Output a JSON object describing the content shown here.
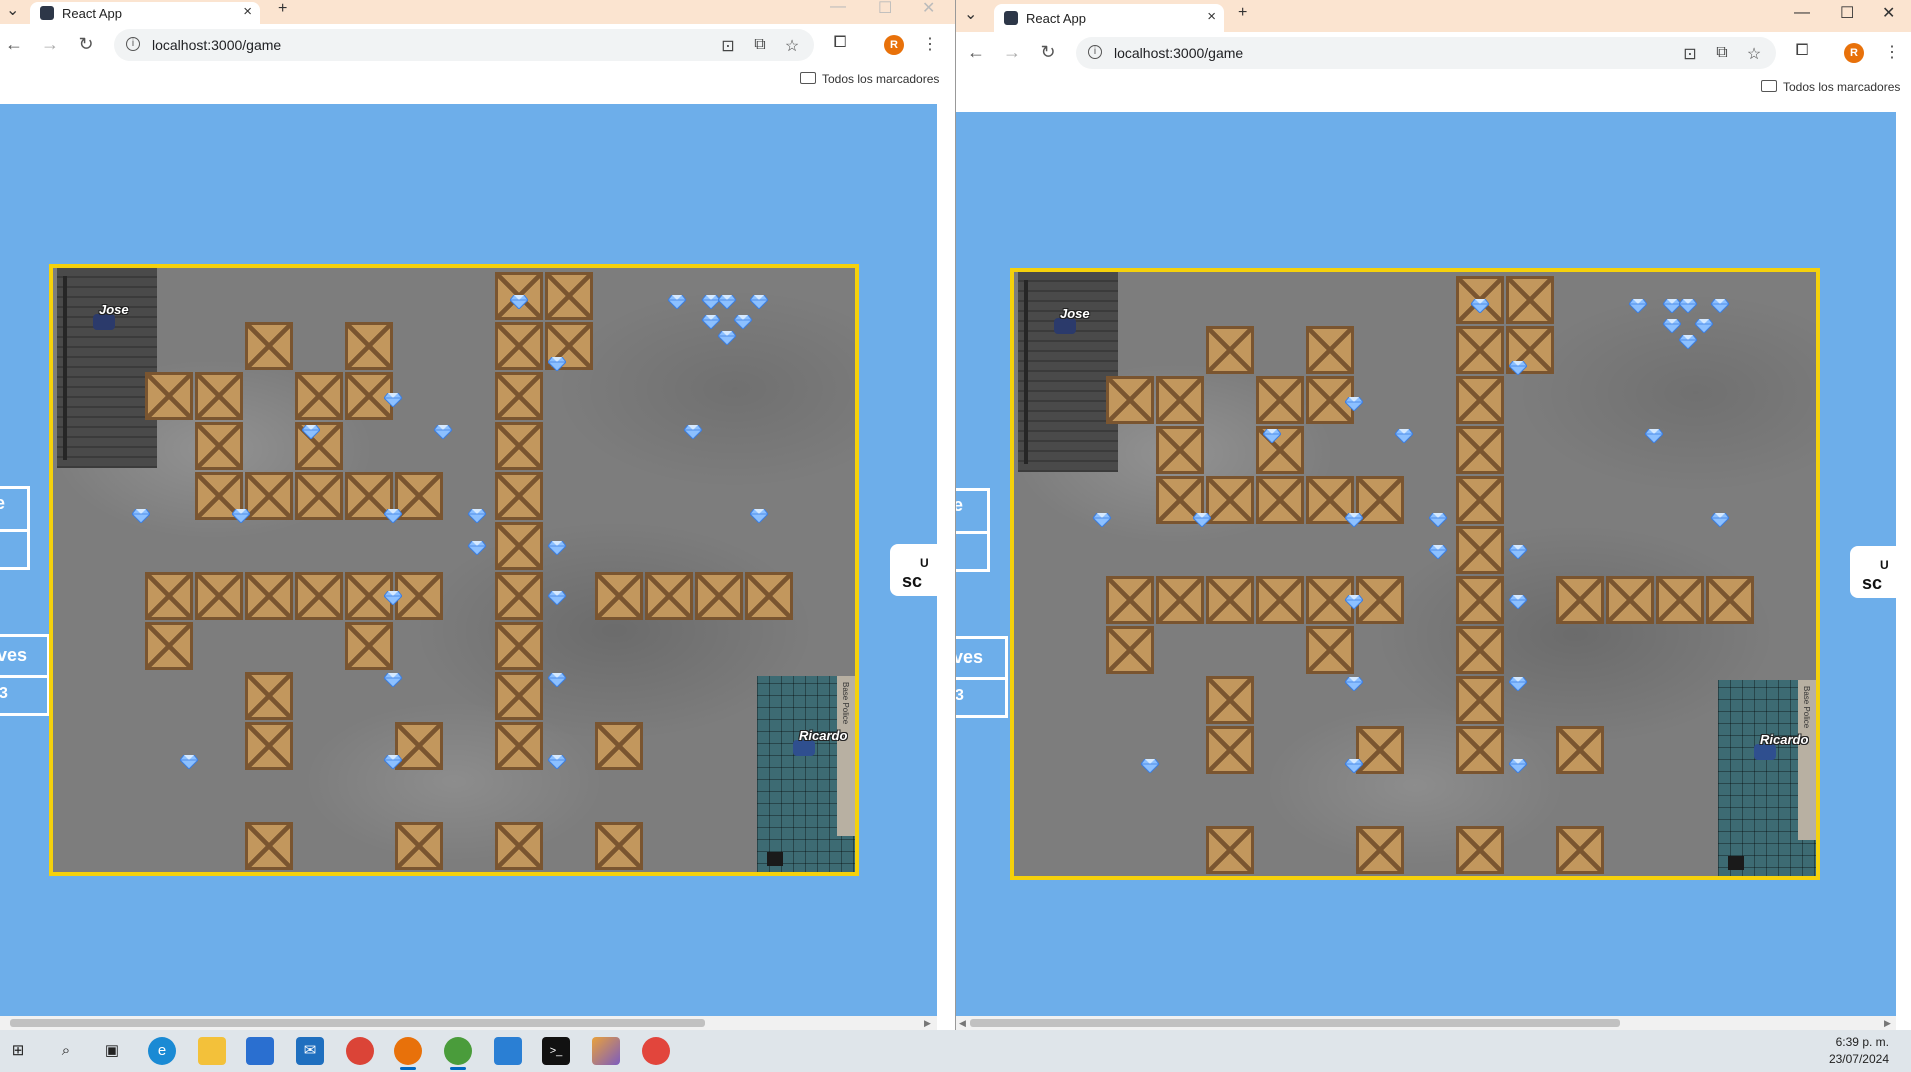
{
  "browser_left": {
    "tab_title": "React App",
    "url": "localhost:3000/game",
    "bookmarks_label": "Todos los marcadores",
    "profile_initial": "R",
    "hud_left": {
      "top_text": "e",
      "bottom_text": "ves",
      "bottom_value": "3"
    },
    "hud_right": {
      "line1": "U",
      "line2": "sc"
    },
    "players": {
      "p1": "Jose",
      "p2": "Ricardo"
    }
  },
  "browser_right": {
    "tab_title": "React App",
    "url": "localhost:3000/game",
    "bookmarks_label": "Todos los marcadores",
    "profile_initial": "R",
    "hud_left": {
      "top_text": "e",
      "bottom_text": "ves",
      "bottom_value": "3"
    },
    "hud_right": {
      "line1": "U",
      "line2": "sc"
    },
    "players": {
      "p1": "Jose",
      "p2": "Ricardo"
    },
    "base_sign": "Base Police"
  },
  "taskbar": {
    "time": "6:39 p. m.",
    "date": "23/07/2024",
    "apps": [
      "start-icon",
      "search-icon",
      "task-view-icon",
      "edge-icon",
      "file-explorer-icon",
      "store-icon",
      "mail-icon",
      "chrome-icon",
      "chrome-icon",
      "chrome-icon",
      "vscode-icon",
      "terminal-icon",
      "git-icon",
      "paint-icon"
    ]
  },
  "colors": {
    "sky": "#6daeea",
    "board_border": "#f5d10c",
    "tab_bar": "#fbe4d0",
    "crate": "#c2975d",
    "gem": "#7fb6ff"
  }
}
